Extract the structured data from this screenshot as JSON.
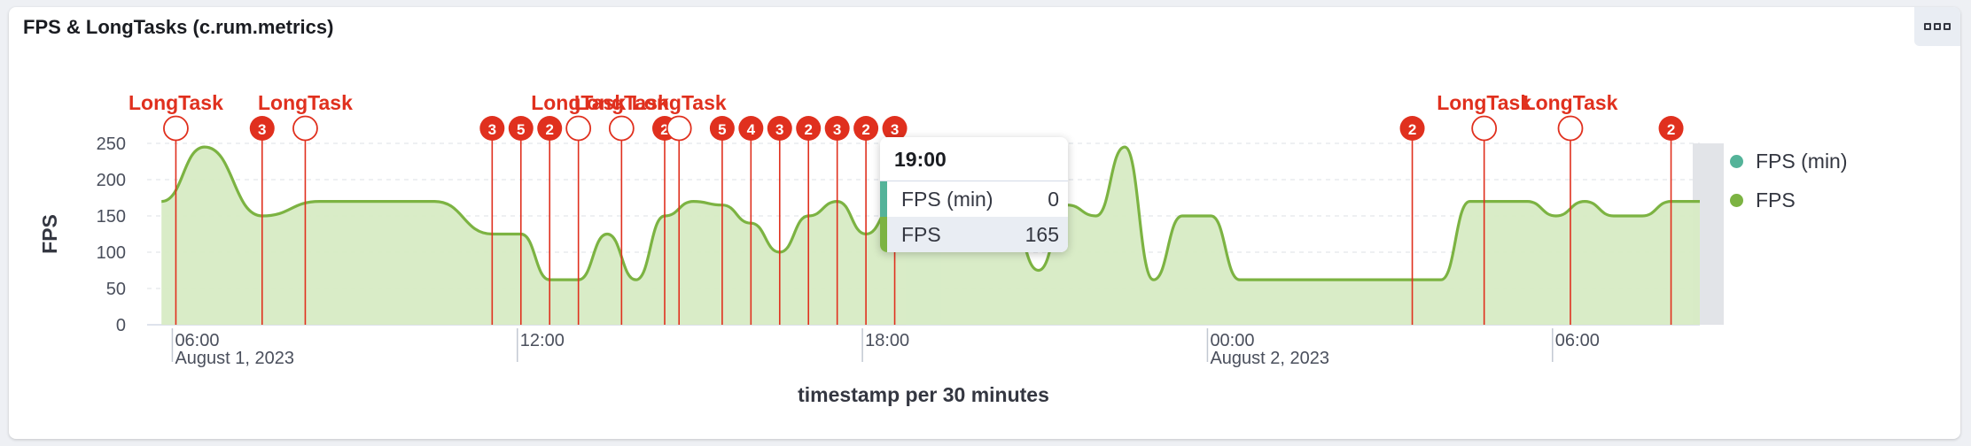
{
  "panel": {
    "title": "FPS & LongTasks (c.rum.metrics)"
  },
  "colors": {
    "fps": "#7cb342",
    "fps_min": "#54b399",
    "marker": "#e0301e",
    "area": "#d7ebc4"
  },
  "legend": [
    {
      "label": "FPS (min)",
      "color": "#54b399"
    },
    {
      "label": "FPS",
      "color": "#7cb342"
    }
  ],
  "tooltip": {
    "time": "19:00",
    "rows": [
      {
        "label": "FPS (min)",
        "value": "0",
        "color": "#54b399"
      },
      {
        "label": "FPS",
        "value": "165",
        "color": "#7cb342"
      }
    ]
  },
  "chart_data": {
    "type": "area",
    "xlabel": "timestamp per 30 minutes",
    "ylabel": "FPS",
    "ylim": [
      0,
      250
    ],
    "yticks": [
      0,
      50,
      100,
      150,
      200,
      250
    ],
    "grid": true,
    "legend_position": "right",
    "x_start": "2023-08-01 05:30",
    "x_end": "2023-08-02 08:30",
    "x_ticks": [
      {
        "time": "2023-08-01 06:00",
        "label": "06:00",
        "sublabel": "August 1, 2023"
      },
      {
        "time": "2023-08-01 12:00",
        "label": "12:00",
        "sublabel": ""
      },
      {
        "time": "2023-08-01 18:00",
        "label": "18:00",
        "sublabel": ""
      },
      {
        "time": "2023-08-02 00:00",
        "label": "00:00",
        "sublabel": "August 2, 2023"
      },
      {
        "time": "2023-08-02 06:00",
        "label": "06:00",
        "sublabel": ""
      }
    ],
    "series": [
      {
        "name": "FPS",
        "points": [
          [
            "2023-08-01 05:45",
            170
          ],
          [
            "2023-08-01 06:30",
            245
          ],
          [
            "2023-08-01 07:30",
            150
          ],
          [
            "2023-08-01 08:30",
            170
          ],
          [
            "2023-08-01 09:30",
            170
          ],
          [
            "2023-08-01 10:30",
            170
          ],
          [
            "2023-08-01 11:30",
            125
          ],
          [
            "2023-08-01 12:00",
            125
          ],
          [
            "2023-08-01 12:30",
            62
          ],
          [
            "2023-08-01 13:00",
            62
          ],
          [
            "2023-08-01 13:30",
            125
          ],
          [
            "2023-08-01 14:00",
            62
          ],
          [
            "2023-08-01 14:30",
            150
          ],
          [
            "2023-08-01 15:00",
            170
          ],
          [
            "2023-08-01 15:30",
            165
          ],
          [
            "2023-08-01 16:00",
            140
          ],
          [
            "2023-08-01 16:30",
            100
          ],
          [
            "2023-08-01 17:00",
            150
          ],
          [
            "2023-08-01 17:30",
            170
          ],
          [
            "2023-08-01 18:00",
            125
          ],
          [
            "2023-08-01 18:30",
            165
          ],
          [
            "2023-08-01 19:00",
            170
          ],
          [
            "2023-08-01 19:30",
            165
          ],
          [
            "2023-08-01 20:00",
            165
          ],
          [
            "2023-08-01 20:30",
            150
          ],
          [
            "2023-08-01 21:00",
            75
          ],
          [
            "2023-08-01 21:30",
            165
          ],
          [
            "2023-08-01 22:00",
            150
          ],
          [
            "2023-08-01 22:30",
            245
          ],
          [
            "2023-08-01 23:00",
            62
          ],
          [
            "2023-08-01 23:30",
            150
          ],
          [
            "2023-08-02 00:00",
            150
          ],
          [
            "2023-08-02 00:30",
            62
          ],
          [
            "2023-08-02 01:00",
            62
          ],
          [
            "2023-08-02 02:00",
            62
          ],
          [
            "2023-08-02 03:00",
            62
          ],
          [
            "2023-08-02 04:00",
            62
          ],
          [
            "2023-08-02 04:30",
            170
          ],
          [
            "2023-08-02 05:00",
            170
          ],
          [
            "2023-08-02 05:30",
            170
          ],
          [
            "2023-08-02 06:00",
            150
          ],
          [
            "2023-08-02 06:30",
            170
          ],
          [
            "2023-08-02 07:00",
            150
          ],
          [
            "2023-08-02 07:30",
            150
          ],
          [
            "2023-08-02 08:00",
            170
          ],
          [
            "2023-08-02 08:30",
            170
          ]
        ]
      }
    ],
    "annotations": [
      {
        "time": "2023-08-01 06:00",
        "label": "LongTask"
      },
      {
        "time": "2023-08-01 07:30",
        "count": "3"
      },
      {
        "time": "2023-08-01 08:15",
        "label": "LongTask"
      },
      {
        "time": "2023-08-01 11:30",
        "count": "3"
      },
      {
        "time": "2023-08-01 12:00",
        "count": "5"
      },
      {
        "time": "2023-08-01 12:30",
        "count": "2"
      },
      {
        "time": "2023-08-01 13:00",
        "label": "LongTask"
      },
      {
        "time": "2023-08-01 13:45",
        "label": "LongTask"
      },
      {
        "time": "2023-08-01 14:30",
        "count": "2"
      },
      {
        "time": "2023-08-01 14:45",
        "label": "LongTask"
      },
      {
        "time": "2023-08-01 15:30",
        "count": "5"
      },
      {
        "time": "2023-08-01 16:00",
        "count": "4"
      },
      {
        "time": "2023-08-01 16:30",
        "count": "3"
      },
      {
        "time": "2023-08-01 17:00",
        "count": "2"
      },
      {
        "time": "2023-08-01 17:30",
        "count": "3"
      },
      {
        "time": "2023-08-01 18:00",
        "count": "2"
      },
      {
        "time": "2023-08-01 18:30",
        "count": "3"
      },
      {
        "time": "2023-08-02 03:30",
        "count": "2"
      },
      {
        "time": "2023-08-02 04:45",
        "label": "LongTask"
      },
      {
        "time": "2023-08-02 06:15",
        "label": "LongTask"
      },
      {
        "time": "2023-08-02 08:00",
        "count": "2"
      }
    ],
    "highlight": {
      "time": "2023-08-01 19:00",
      "value": 165
    }
  }
}
